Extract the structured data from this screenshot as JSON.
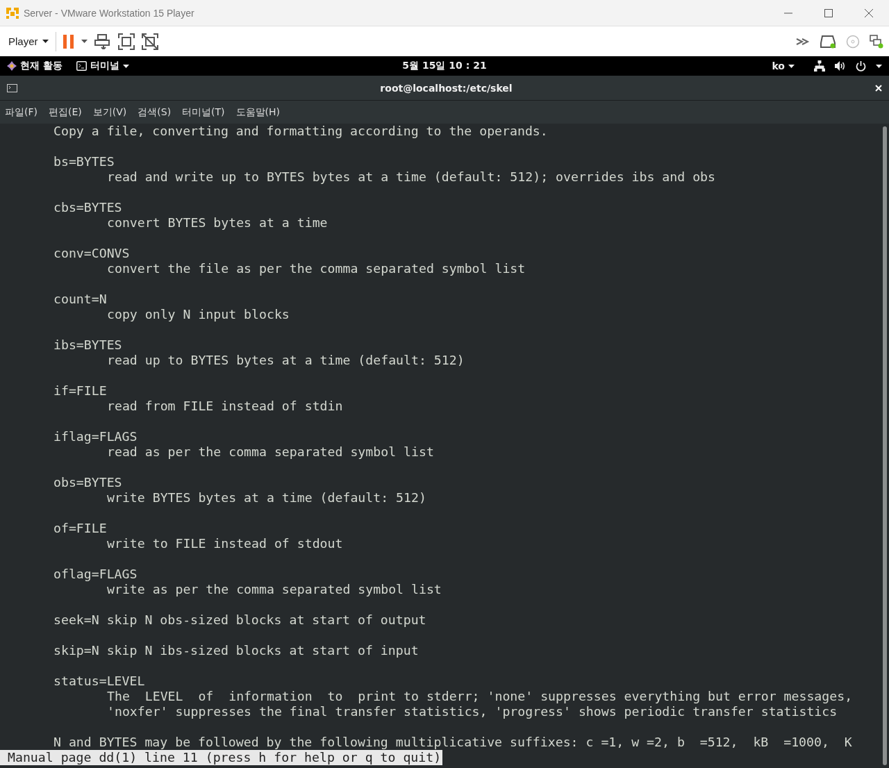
{
  "window": {
    "title": "Server - VMware Workstation 15 Player"
  },
  "toolbar": {
    "player_menu": "Player"
  },
  "top_bar": {
    "activities": "현재 활동",
    "app_menu": "터미널",
    "clock": "5월 15일  10 : 21",
    "input_method": "ko"
  },
  "terminal": {
    "title": "root@localhost:/etc/skel",
    "menu": [
      "파일(F)",
      "편집(E)",
      "보기(V)",
      "검색(S)",
      "터미널(T)",
      "도움말(H)"
    ],
    "paragraphs": [
      [
        {
          "kind": "option",
          "text": "Copy a file, converting and formatting according to the operands."
        }
      ],
      [
        {
          "kind": "option",
          "text": "bs=BYTES"
        },
        {
          "kind": "desc",
          "text": "read and write up to BYTES bytes at a time (default: 512); overrides ibs and obs"
        }
      ],
      [
        {
          "kind": "option",
          "text": "cbs=BYTES"
        },
        {
          "kind": "desc",
          "text": "convert BYTES bytes at a time"
        }
      ],
      [
        {
          "kind": "option",
          "text": "conv=CONVS"
        },
        {
          "kind": "desc",
          "text": "convert the file as per the comma separated symbol list"
        }
      ],
      [
        {
          "kind": "option",
          "text": "count=N"
        },
        {
          "kind": "desc",
          "text": "copy only N input blocks"
        }
      ],
      [
        {
          "kind": "option",
          "text": "ibs=BYTES"
        },
        {
          "kind": "desc",
          "text": "read up to BYTES bytes at a time (default: 512)"
        }
      ],
      [
        {
          "kind": "option",
          "text": "if=FILE"
        },
        {
          "kind": "desc",
          "text": "read from FILE instead of stdin"
        }
      ],
      [
        {
          "kind": "option",
          "text": "iflag=FLAGS"
        },
        {
          "kind": "desc",
          "text": "read as per the comma separated symbol list"
        }
      ],
      [
        {
          "kind": "option",
          "text": "obs=BYTES"
        },
        {
          "kind": "desc",
          "text": "write BYTES bytes at a time (default: 512)"
        }
      ],
      [
        {
          "kind": "option",
          "text": "of=FILE"
        },
        {
          "kind": "desc",
          "text": "write to FILE instead of stdout"
        }
      ],
      [
        {
          "kind": "option",
          "text": "oflag=FLAGS"
        },
        {
          "kind": "desc",
          "text": "write as per the comma separated symbol list"
        }
      ],
      [
        {
          "kind": "option",
          "text": "seek=N skip N obs-sized blocks at start of output"
        }
      ],
      [
        {
          "kind": "option",
          "text": "skip=N skip N ibs-sized blocks at start of input"
        }
      ],
      [
        {
          "kind": "option",
          "text": "status=LEVEL"
        },
        {
          "kind": "desc",
          "text": "The  LEVEL  of  information  to  print to stderr; 'none' suppresses everything but error messages,"
        },
        {
          "kind": "desc",
          "text": "'noxfer' suppresses the final transfer statistics, 'progress' shows periodic transfer statistics"
        }
      ],
      [
        {
          "kind": "option",
          "text": "N and BYTES may be followed by the following multiplicative suffixes: c =1, w =2, b  =512,  kB  =1000,  K"
        }
      ]
    ],
    "status_line": "Manual page dd(1) line 11 (press h for help or q to quit)"
  }
}
